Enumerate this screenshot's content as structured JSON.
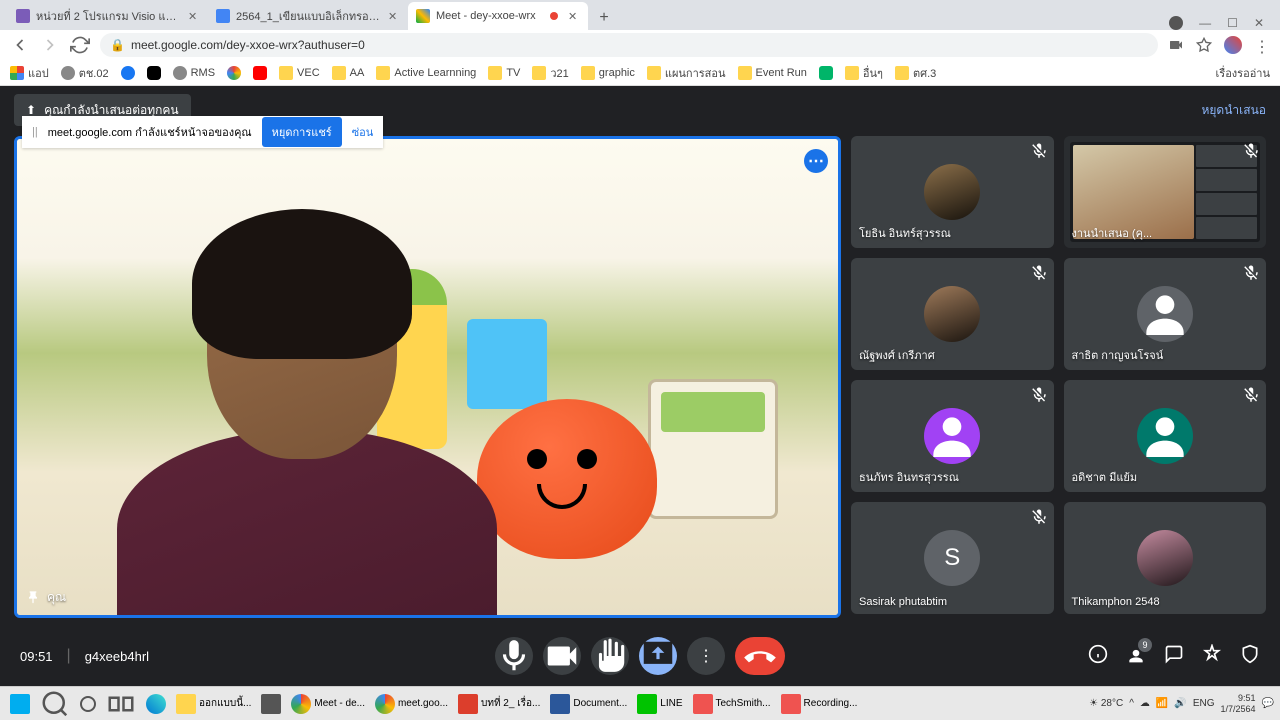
{
  "tabs": [
    {
      "label": "หน่วยที่ 2 โปรแกรม Visio และการใช้..."
    },
    {
      "label": "2564_1_เขียนแบบอิเล็กทรอนิกส์ด้วย..."
    },
    {
      "label": "Meet - dey-xxoe-wrx"
    }
  ],
  "url": "meet.google.com/dey-xxoe-wrx?authuser=0",
  "bookmarks": [
    "แอป",
    "ตช.02",
    "",
    "",
    "RMS",
    "",
    "",
    "VEC",
    "AA",
    "Active Learnning",
    "TV",
    "ว21",
    "graphic",
    "แผนการสอน",
    "Event Run",
    "",
    "อื่นๆ",
    "ตศ.3"
  ],
  "bookmarks_right": "เรื่องรออ่าน",
  "banner": {
    "text": "คุณกำลังนำเสนอต่อทุกคน",
    "stop": "หยุดนำเสนอ"
  },
  "share": {
    "text": "meet.google.com กำลังแชร์หน้าจอของคุณ",
    "stop": "หยุดการแชร์",
    "hide": "ซ่อน"
  },
  "main_label": "คุณ",
  "participants": [
    {
      "name": "โยธิน อินทร์สุวรรณ",
      "color": "#8b6f4a",
      "img": true,
      "muted": true
    },
    {
      "name": "งานนำเสนอ (คุ...",
      "screen": true,
      "muted": true
    },
    {
      "name": "ณัฐพงศ์ เกรีภาศ",
      "color": "#9e7a5a",
      "img": true,
      "muted": true
    },
    {
      "name": "สาธิต กาญจนโรจน์",
      "color": "#5f6368",
      "letter": "",
      "muted": true
    },
    {
      "name": "ธนภัทร อินทรสุวรรณ",
      "color": "#a142f4",
      "letter": "",
      "muted": true
    },
    {
      "name": "อดิชาต มีแย้ม",
      "color": "#00796b",
      "letter": "",
      "muted": true
    },
    {
      "name": "Sasirak phutabtim",
      "color": "#5f6368",
      "letter": "S",
      "muted": true
    },
    {
      "name": "Thikamphon 2548",
      "color": "#c48b9f",
      "img": true,
      "muted": false
    }
  ],
  "time": "09:51",
  "code": "g4xeeb4hrl",
  "people_count": "9",
  "taskbar": {
    "items": [
      "ออกแบบนี้...",
      "",
      "Meet - de...",
      "meet.goo...",
      "บทที่ 2_ เรื่อ...",
      "Document...",
      "LINE",
      "TechSmith...",
      "Recording..."
    ],
    "weather": "28°C",
    "lang": "ENG",
    "time": "9:51",
    "date": "1/7/2564"
  }
}
